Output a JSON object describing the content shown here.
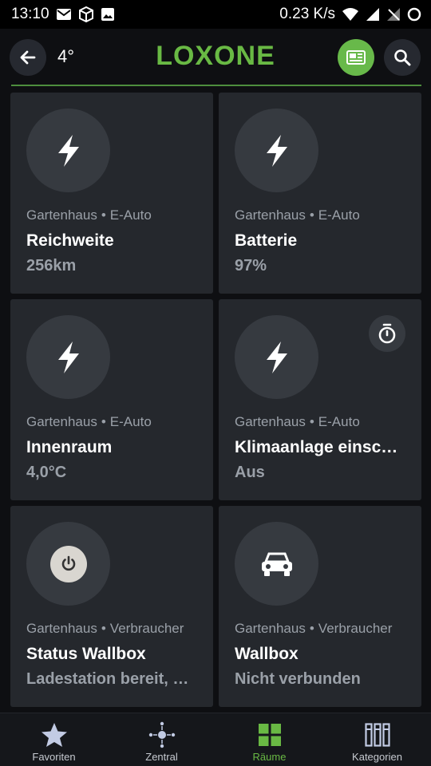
{
  "statusbar": {
    "time": "13:10",
    "speed": "0.23 K/s"
  },
  "header": {
    "temperature": "4°",
    "brand": "LOXONE"
  },
  "cards": [
    {
      "room": "Gartenhaus",
      "category": "E-Auto",
      "title": "Reichweite",
      "value": "256km",
      "icon": "lightning-icon"
    },
    {
      "room": "Gartenhaus",
      "category": "E-Auto",
      "title": "Batterie",
      "value": "97%",
      "icon": "lightning-icon"
    },
    {
      "room": "Gartenhaus",
      "category": "E-Auto",
      "title": "Innenraum",
      "value": "4,0°C",
      "icon": "lightning-icon"
    },
    {
      "room": "Gartenhaus",
      "category": "E-Auto",
      "title": "Klimaanlage einsc…",
      "value": "Aus",
      "icon": "lightning-icon",
      "badge": "timer-icon"
    },
    {
      "room": "Gartenhaus",
      "category": "Verbraucher",
      "title": "Status Wallbox",
      "value": "Ladestation bereit, …",
      "icon": "power-icon"
    },
    {
      "room": "Gartenhaus",
      "category": "Verbraucher",
      "title": "Wallbox",
      "value": "Nicht verbunden",
      "icon": "car-icon"
    }
  ],
  "nav": [
    {
      "label": "Favoriten",
      "icon": "star-icon"
    },
    {
      "label": "Zentral",
      "icon": "central-hub-icon"
    },
    {
      "label": "Räume",
      "icon": "rooms-grid-icon",
      "active": true
    },
    {
      "label": "Kategorien",
      "icon": "categories-icon"
    }
  ],
  "colors": {
    "accent": "#69b944",
    "background": "#0e0f12",
    "card": "#25282d",
    "muted_text": "#9aa0a8"
  }
}
